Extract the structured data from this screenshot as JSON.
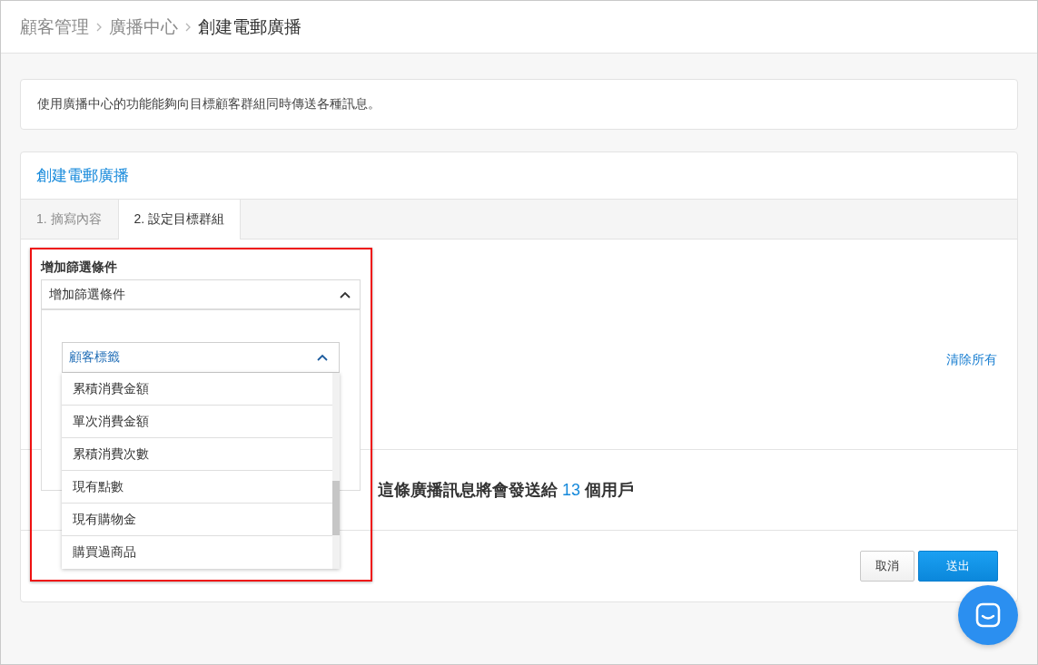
{
  "breadcrumb": [
    {
      "label": "顧客管理",
      "selected": false
    },
    {
      "label": "廣播中心",
      "selected": false
    },
    {
      "label": "創建電郵廣播",
      "selected": true
    }
  ],
  "notice": "使用廣播中心的功能能夠向目標顧客群組同時傳送各種訊息。",
  "card": {
    "title": "創建電郵廣播",
    "tabs": [
      {
        "label": "1. 摘寫內容",
        "selected": false
      },
      {
        "label": "2. 設定目標群組",
        "selected": true
      }
    ]
  },
  "filter": {
    "label": "增加篩選條件",
    "select": {
      "value": "增加篩選條件",
      "expanded": true
    },
    "sub_select": {
      "value": "顧客標籤",
      "expanded": true,
      "options": [
        "累積消費金額",
        "單次消費金額",
        "累積消費次數",
        "現有點數",
        "現有購物金",
        "購買過商品"
      ]
    }
  },
  "clear_all": "清除所有",
  "recipients": {
    "before": "這條廣播訊息將會發送給",
    "count": "13",
    "after": "個用戶"
  },
  "buttons": [
    {
      "label": "取消",
      "kind": "secondary"
    },
    {
      "label": "送出",
      "kind": "primary"
    }
  ]
}
